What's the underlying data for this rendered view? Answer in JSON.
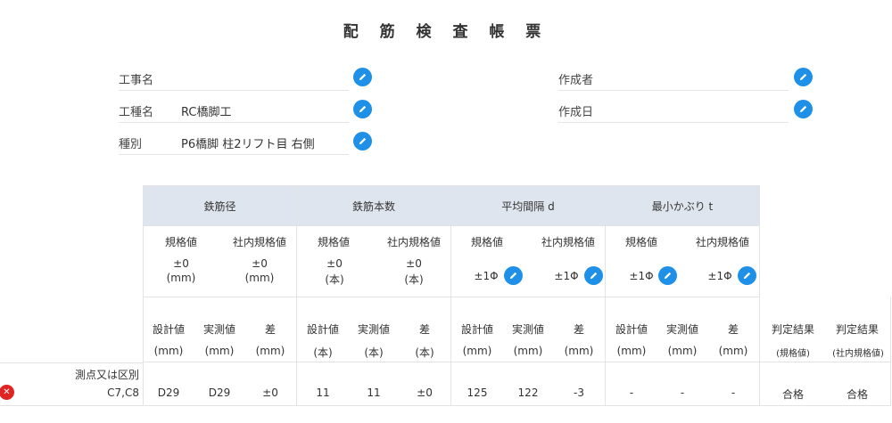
{
  "title": "配 筋 検 査 帳 票",
  "fields": {
    "kouji_label": "工事名",
    "kouji_value": "",
    "koushu_label": "工種名",
    "koushu_value": "RC橋脚工",
    "shubetsu_label": "種別",
    "shubetsu_value": "P6橋脚 柱2リフト目 右側",
    "sakuseisha_label": "作成者",
    "sakuseisha_value": "",
    "sakuseibi_label": "作成日",
    "sakuseibi_value": ""
  },
  "table": {
    "groups": [
      "鉄筋径",
      "鉄筋本数",
      "平均間隔 d",
      "最小かぶり t"
    ],
    "spec_label": "規格値",
    "inhouse_label": "社内規格値",
    "spec_values": {
      "g1_spec": "±0",
      "g1_spec_unit": "(mm)",
      "g1_in": "±0",
      "g1_in_unit": "(mm)",
      "g2_spec": "±0",
      "g2_spec_unit": "(本)",
      "g2_in": "±0",
      "g2_in_unit": "(本)",
      "g3_spec": "±1Φ",
      "g3_in": "±1Φ",
      "g4_spec": "±1Φ",
      "g4_in": "±1Φ"
    },
    "col_heads": {
      "design": "設計値",
      "actual": "実測値",
      "diff": "差",
      "unit_mm": "(mm)",
      "unit_hon": "(本)",
      "result_spec": "判定結果",
      "result_spec_sub": "(規格値)",
      "result_in": "判定結果",
      "result_in_sub": "(社内規格値)"
    },
    "row": {
      "label1": "測点又は区別",
      "label2": "C7,C8",
      "values": [
        "D29",
        "D29",
        "±0",
        "11",
        "11",
        "±0",
        "125",
        "122",
        "-3",
        "-",
        "-",
        "-",
        "合格",
        "合格"
      ]
    }
  }
}
